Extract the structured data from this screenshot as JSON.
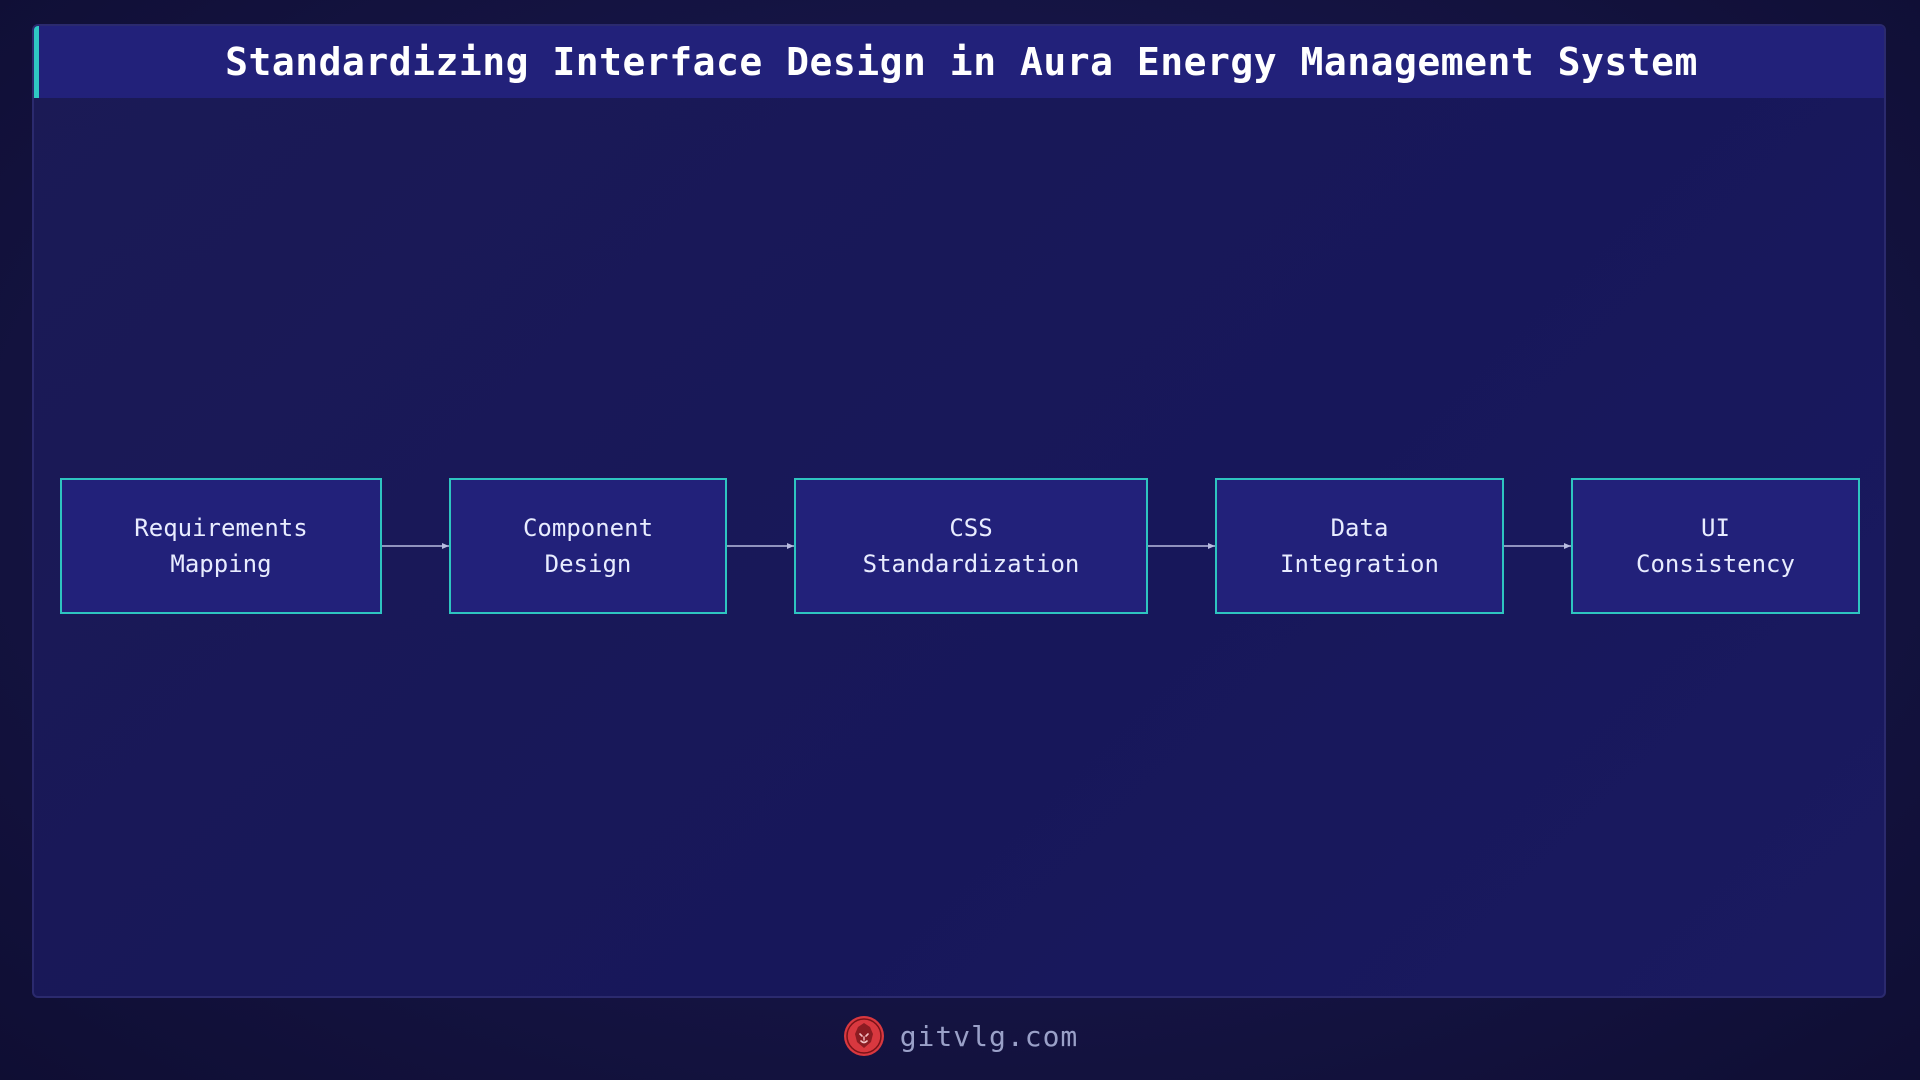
{
  "title": "Standardizing Interface Design in Aura Energy Management System",
  "colors": {
    "background": "#13123a",
    "panel": "#1b1a55",
    "title_bar": "#22217a",
    "accent": "#2ec4c0",
    "node_fill": "#22217a",
    "node_text": "#e8ecff",
    "arrow": "#b8bce0",
    "footer_text": "#9aa0c8",
    "logo": "#d9383f"
  },
  "flow": {
    "nodes": [
      {
        "label": "Requirements\nMapping"
      },
      {
        "label": "Component\nDesign"
      },
      {
        "label": "CSS\nStandardization"
      },
      {
        "label": "Data\nIntegration"
      },
      {
        "label": "UI\nConsistency"
      }
    ],
    "edges": [
      {
        "from": 0,
        "to": 1
      },
      {
        "from": 1,
        "to": 2
      },
      {
        "from": 2,
        "to": 3
      },
      {
        "from": 3,
        "to": 4
      }
    ]
  },
  "footer": {
    "logo_icon": "lion-head-icon",
    "text": "gitvlg.com"
  }
}
